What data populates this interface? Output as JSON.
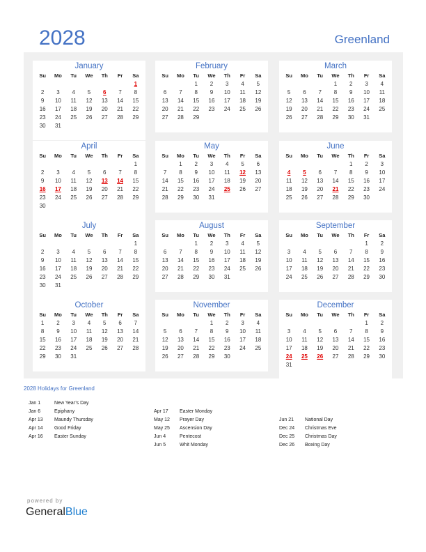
{
  "header": {
    "year": "2028",
    "country": "Greenland"
  },
  "weekdays": [
    "Su",
    "Mo",
    "Tu",
    "We",
    "Th",
    "Fr",
    "Sa"
  ],
  "months": [
    {
      "name": "January",
      "start": 6,
      "days": 31,
      "holidays": [
        1,
        6
      ]
    },
    {
      "name": "February",
      "start": 2,
      "days": 29,
      "holidays": []
    },
    {
      "name": "March",
      "start": 3,
      "days": 31,
      "holidays": []
    },
    {
      "name": "April",
      "start": 6,
      "days": 30,
      "holidays": [
        13,
        14,
        16,
        17
      ]
    },
    {
      "name": "May",
      "start": 1,
      "days": 31,
      "holidays": [
        12,
        25
      ]
    },
    {
      "name": "June",
      "start": 4,
      "days": 30,
      "holidays": [
        4,
        5,
        21
      ]
    },
    {
      "name": "July",
      "start": 6,
      "days": 31,
      "holidays": []
    },
    {
      "name": "August",
      "start": 2,
      "days": 31,
      "holidays": []
    },
    {
      "name": "September",
      "start": 5,
      "days": 30,
      "holidays": []
    },
    {
      "name": "October",
      "start": 0,
      "days": 31,
      "holidays": []
    },
    {
      "name": "November",
      "start": 3,
      "days": 30,
      "holidays": []
    },
    {
      "name": "December",
      "start": 5,
      "days": 31,
      "holidays": [
        24,
        25,
        26
      ]
    }
  ],
  "holidays_title": "2028 Holidays for Greenland",
  "holiday_columns": [
    [
      {
        "date": "Jan 1",
        "name": "New Year’s Day"
      },
      {
        "date": "Jan 6",
        "name": "Epiphany"
      },
      {
        "date": "Apr 13",
        "name": "Maundy Thursday"
      },
      {
        "date": "Apr 14",
        "name": "Good Friday"
      },
      {
        "date": "Apr 16",
        "name": "Easter Sunday"
      }
    ],
    [
      {
        "date": "Apr 17",
        "name": "Easter Monday"
      },
      {
        "date": "May 12",
        "name": "Prayer Day"
      },
      {
        "date": "May 25",
        "name": "Ascension Day"
      },
      {
        "date": "Jun 4",
        "name": "Pentecost"
      },
      {
        "date": "Jun 5",
        "name": "Whit Monday"
      }
    ],
    [
      {
        "date": "Jun 21",
        "name": "National Day"
      },
      {
        "date": "Dec 24",
        "name": "Christmas Eve"
      },
      {
        "date": "Dec 25",
        "name": "Christmas Day"
      },
      {
        "date": "Dec 26",
        "name": "Boxing Day"
      }
    ]
  ],
  "footer": {
    "powered_by": "powered by",
    "brand_general": "General",
    "brand_blue": "Blue"
  },
  "colors": {
    "accent": "#4472c4",
    "holiday": "#e00000",
    "panel": "#f0f0f0",
    "brand_blue": "#1e7fd0"
  }
}
